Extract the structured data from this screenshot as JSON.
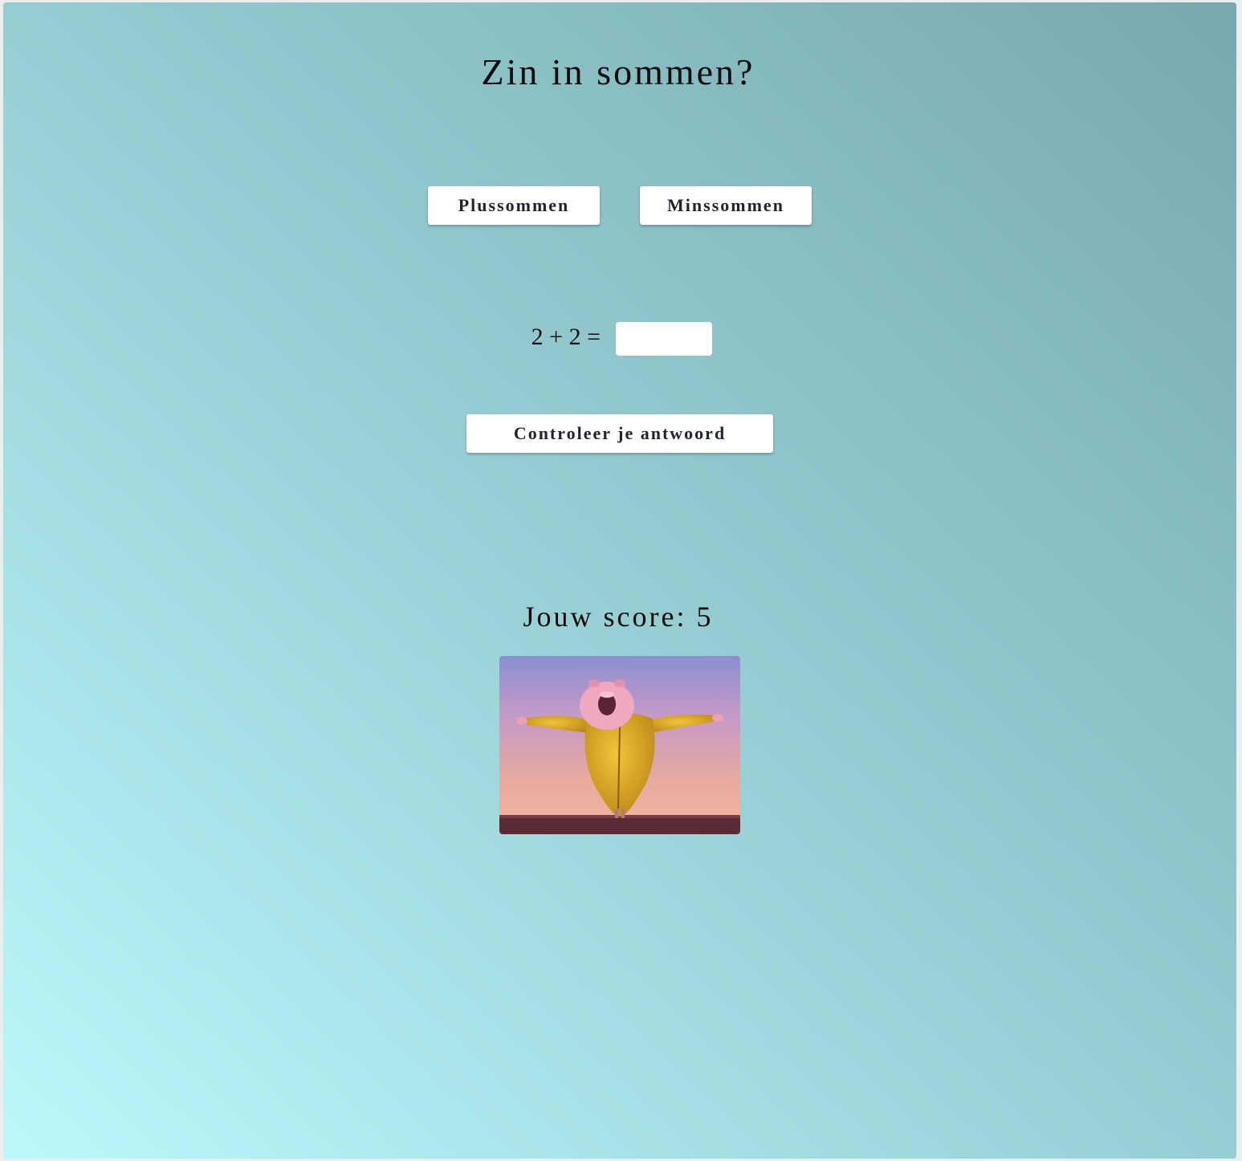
{
  "page": {
    "title": "Zin in sommen?"
  },
  "modes": {
    "plus_label": "Plussommen",
    "minus_label": "Minssommen"
  },
  "exercise": {
    "question": "2 + 2 =",
    "answer_value": "",
    "check_label": "Controleer je antwoord"
  },
  "score": {
    "label": "Jouw score:",
    "value": "5"
  },
  "reward_image": {
    "description_icon": "singing-pig-gif"
  },
  "colors": {
    "gradient_light": "#bcf7fa",
    "gradient_dark": "#76a9ad",
    "button_bg": "#ffffff",
    "button_text": "#1f2430"
  }
}
